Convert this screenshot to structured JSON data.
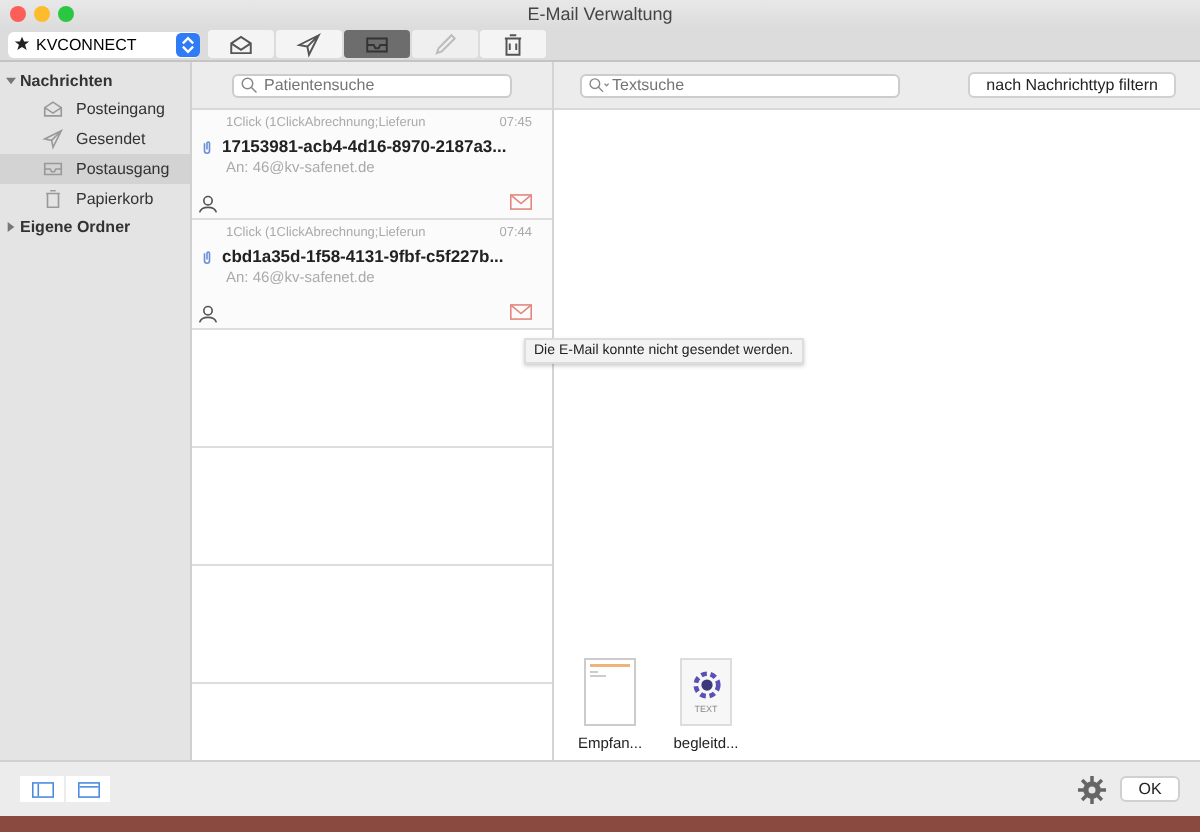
{
  "window": {
    "title": "E-Mail Verwaltung"
  },
  "account_select": {
    "value": "KVCONNECT"
  },
  "toolbar": [
    {
      "kind": "inbox",
      "selected": false,
      "disabled": false
    },
    {
      "kind": "send",
      "selected": false,
      "disabled": false
    },
    {
      "kind": "outbox",
      "selected": true,
      "disabled": false
    },
    {
      "kind": "edit",
      "selected": false,
      "disabled": true
    },
    {
      "kind": "trash",
      "selected": false,
      "disabled": false
    }
  ],
  "sidebar": {
    "items": [
      {
        "label": "Nachrichten",
        "expanded": true,
        "children": [
          {
            "label": "Posteingang",
            "kind": "inbox",
            "selected": false
          },
          {
            "label": "Gesendet",
            "kind": "send",
            "selected": false
          },
          {
            "label": "Postausgang",
            "kind": "outbox",
            "selected": true
          },
          {
            "label": "Papierkorb",
            "kind": "trash",
            "selected": false
          }
        ]
      },
      {
        "label": "Eigene Ordner",
        "expanded": false
      }
    ]
  },
  "patient_search": {
    "placeholder": "Patientensuche"
  },
  "text_search": {
    "placeholder": "Textsuche"
  },
  "filter_button": "nach Nachrichttyp filtern",
  "messages": [
    {
      "sender": "1Click (1ClickAbrechnung;Lieferun",
      "time": "07:45",
      "subject": "17153981-acb4-4d16-8970-2187a3...",
      "recipient": "An: 46@kv-safenet.de"
    },
    {
      "sender": "1Click (1ClickAbrechnung;Lieferun",
      "time": "07:44",
      "subject": "cbd1a35d-1f58-4131-9fbf-c5f227b...",
      "recipient": "An: 46@kv-safenet.de"
    }
  ],
  "tooltip": "Die E-Mail konnte nicht gesendet werden.",
  "attachments": [
    {
      "kind": "document",
      "name": "Empfan..."
    },
    {
      "kind": "text",
      "name": "begleitd...",
      "badge": "TEXT"
    }
  ],
  "ok_button": "OK"
}
